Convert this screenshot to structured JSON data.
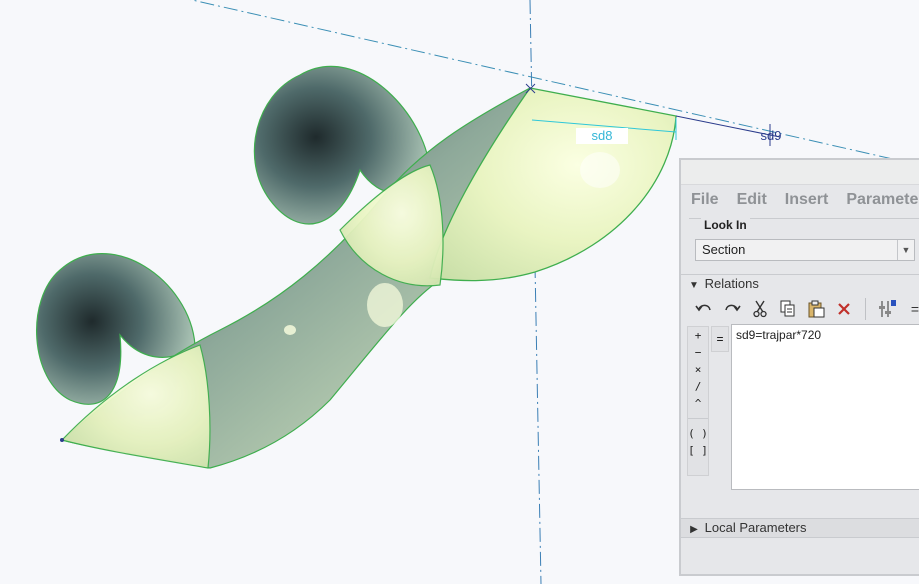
{
  "viewport": {
    "dimension_sd8": "sd8",
    "dimension_sd9": "sd9"
  },
  "dialog": {
    "menu": [
      "File",
      "Edit",
      "Insert",
      "Paramete"
    ],
    "look_in": {
      "label": "Look In",
      "value": "Section"
    },
    "relations_label": "Relations",
    "side_tools": [
      "+",
      "−",
      "×",
      "/",
      "^",
      "( )",
      "[ ]"
    ],
    "equals": "=",
    "relation_text": "sd9=trajpar*720",
    "local_parameters_label": "Local Parameters",
    "toolbar_icons": [
      "undo-icon",
      "redo-icon",
      "cut-icon",
      "copy-icon",
      "paste-icon",
      "delete-icon",
      "sort-icon",
      "equals-icon"
    ]
  }
}
